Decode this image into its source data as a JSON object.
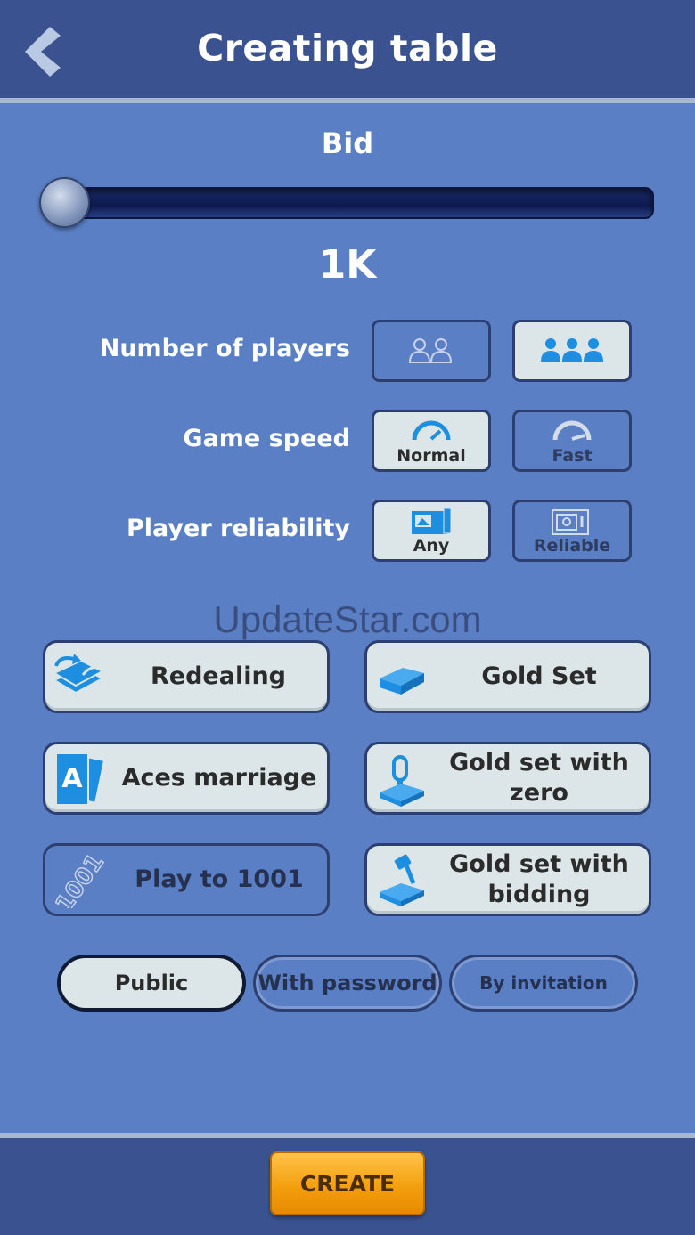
{
  "header": {
    "title": "Creating table"
  },
  "bid": {
    "label": "Bid",
    "value": "1K",
    "slider_position": 0
  },
  "settings": {
    "players_label": "Number of players",
    "speed_label": "Game speed",
    "reliability_label": "Player reliability",
    "speed_options": [
      "Normal",
      "Fast"
    ],
    "reliability_options": [
      "Any",
      "Reliable"
    ],
    "selected": {
      "players": 3,
      "speed": "Normal",
      "reliability": "Any"
    }
  },
  "features": {
    "redealing": "Redealing",
    "gold_set": "Gold Set",
    "aces_marriage": "Aces marriage",
    "gold_set_zero": "Gold set with zero",
    "play_to_1001": "Play to 1001",
    "gold_set_bidding": "Gold set with bidding",
    "icon_1001_text": "1001"
  },
  "privacy": {
    "options": [
      "Public",
      "With password",
      "By invitation"
    ],
    "selected": "Public"
  },
  "footer": {
    "create_label": "CREATE"
  },
  "watermark": "UpdateStar.com",
  "colors": {
    "accent": "#f3a00e",
    "background": "#5a7fc4",
    "header": "#3a5390",
    "icon_blue": "#1e8fe0"
  }
}
